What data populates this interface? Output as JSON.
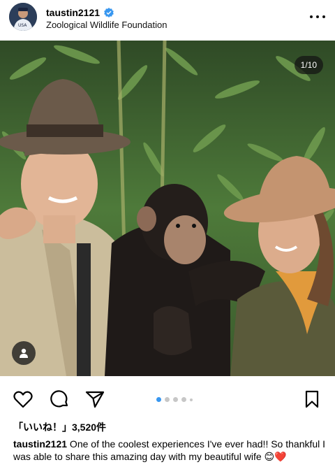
{
  "post": {
    "username": "taustin2121",
    "location": "Zoological Wildlife Foundation",
    "carousel_counter": "1/10",
    "likes": "「いいね！」3,520件",
    "caption_text": " One of the coolest experiences I've ever had!! So thankful I was able to share this amazing day with my beautiful wife ",
    "caption_emojis": "😊❤️"
  },
  "icons": {
    "verified": "verified-badge-icon",
    "more": "more-options-icon",
    "like": "heart-icon",
    "comment": "comment-icon",
    "share": "paper-plane-icon",
    "save": "bookmark-icon",
    "tags": "person-tag-icon"
  },
  "colors": {
    "verified": "#3897f0",
    "active_dot": "#3897f0",
    "inactive_dot": "#c7c7c7"
  },
  "carousel": {
    "total": 10,
    "current": 1
  }
}
